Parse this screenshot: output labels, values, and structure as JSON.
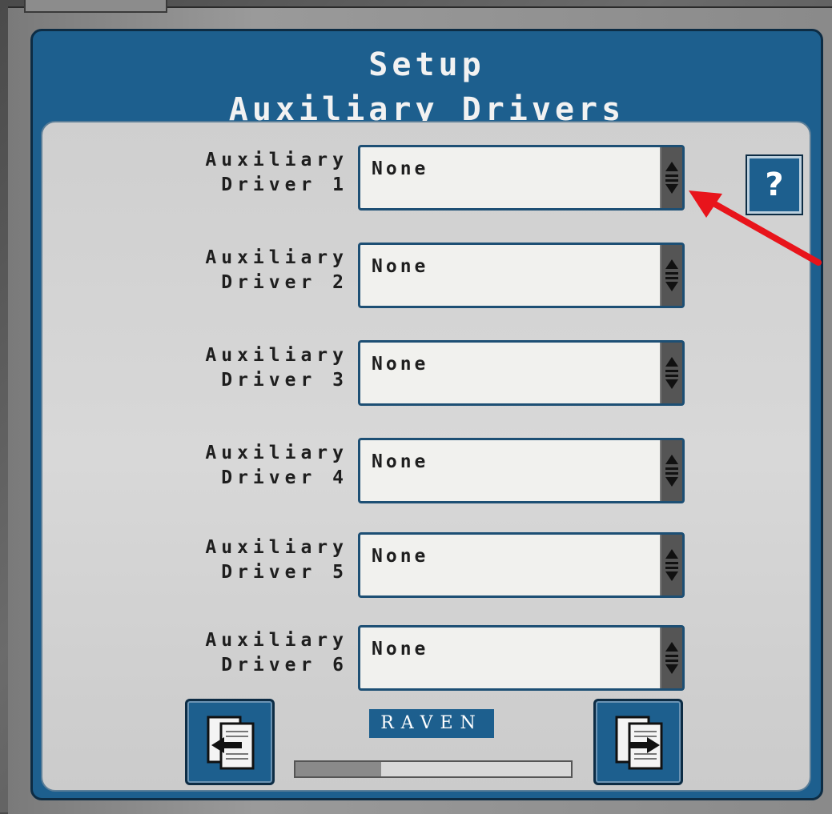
{
  "header": {
    "line1": "Setup",
    "line2": "Auxiliary Drivers"
  },
  "drivers": [
    {
      "label_top": "Auxiliary",
      "label_bottom": "Driver 1",
      "value": "None"
    },
    {
      "label_top": "Auxiliary",
      "label_bottom": "Driver 2",
      "value": "None"
    },
    {
      "label_top": "Auxiliary",
      "label_bottom": "Driver 3",
      "value": "None"
    },
    {
      "label_top": "Auxiliary",
      "label_bottom": "Driver 4",
      "value": "None"
    },
    {
      "label_top": "Auxiliary",
      "label_bottom": "Driver 5",
      "value": "None"
    },
    {
      "label_top": "Auxiliary",
      "label_bottom": "Driver 6",
      "value": "None"
    }
  ],
  "help": {
    "label": "?"
  },
  "footer": {
    "logo": "RAVEN",
    "progress_fraction": 0.31
  },
  "icons": {
    "back": "page-back-icon",
    "next": "page-next-icon",
    "spinner": "up-down-spinner-icon",
    "annotation": "red-arrow-annotation"
  },
  "colors": {
    "header_blue": "#1d5f8e",
    "panel_gray": "#d2d2d2",
    "annotation_red": "#e8141b"
  }
}
